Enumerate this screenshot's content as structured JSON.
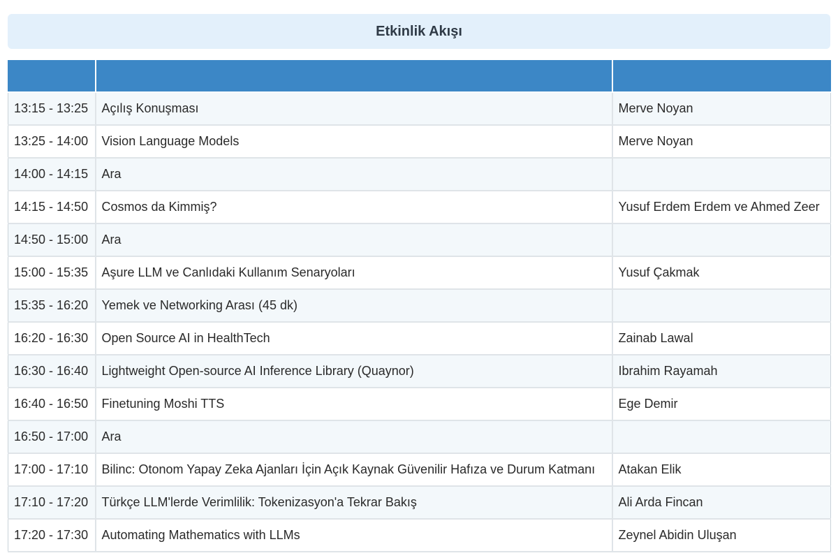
{
  "header": {
    "title": "Etkinlik Akışı"
  },
  "table": {
    "columns": [
      "",
      "",
      ""
    ],
    "rows": [
      {
        "time": "13:15 - 13:25",
        "title": "Açılış Konuşması",
        "speaker": "Merve Noyan"
      },
      {
        "time": "13:25 - 14:00",
        "title": "Vision Language Models",
        "speaker": "Merve Noyan"
      },
      {
        "time": "14:00 - 14:15",
        "title": "Ara",
        "speaker": ""
      },
      {
        "time": "14:15 - 14:50",
        "title": "Cosmos da Kimmiş?",
        "speaker": "Yusuf Erdem Erdem ve Ahmed Zeer"
      },
      {
        "time": "14:50 - 15:00",
        "title": "Ara",
        "speaker": ""
      },
      {
        "time": "15:00 - 15:35",
        "title": "Aşure LLM ve Canlıdaki Kullanım Senaryoları",
        "speaker": "Yusuf Çakmak"
      },
      {
        "time": "15:35 - 16:20",
        "title": "Yemek ve Networking Arası (45 dk)",
        "speaker": ""
      },
      {
        "time": "16:20 - 16:30",
        "title": "Open Source AI in HealthTech",
        "speaker": "Zainab Lawal"
      },
      {
        "time": "16:30 - 16:40",
        "title": "Lightweight Open-source AI Inference Library (Quaynor)",
        "speaker": "Ibrahim Rayamah"
      },
      {
        "time": "16:40 - 16:50",
        "title": "Finetuning Moshi TTS",
        "speaker": "Ege Demir"
      },
      {
        "time": "16:50 - 17:00",
        "title": "Ara",
        "speaker": ""
      },
      {
        "time": "17:00 - 17:10",
        "title": "Bilinc: Otonom Yapay Zeka Ajanları İçin Açık Kaynak Güvenilir Hafıza ve Durum Katmanı",
        "speaker": "Atakan Elik"
      },
      {
        "time": "17:10 - 17:20",
        "title": "Türkçe LLM'lerde Verimlilik: Tokenizasyon'a Tekrar Bakış",
        "speaker": "Ali Arda Fincan"
      },
      {
        "time": "17:20 - 17:30",
        "title": "Automating Mathematics with LLMs",
        "speaker": "Zeynel Abidin Uluşan"
      }
    ]
  },
  "colors": {
    "banner_bg": "#e3f0fb",
    "header_bg": "#3c87c6",
    "row_alt_bg": "#f3f8fb",
    "border": "#dfe4e8"
  }
}
